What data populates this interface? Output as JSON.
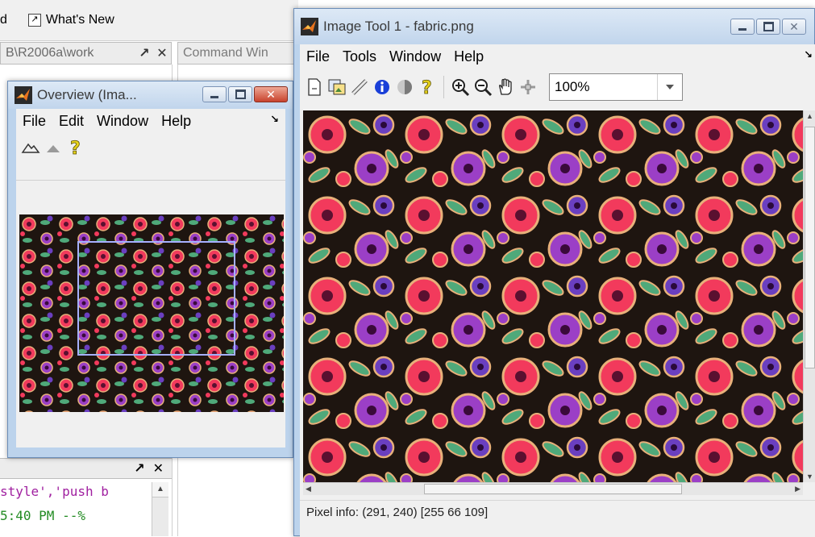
{
  "desktop": {
    "menu_fragment": "d",
    "whats_new": "What's New",
    "current_folder_path": "B\\R2006a\\work",
    "pane_undock": "↗",
    "pane_close": "✕",
    "command_window_title": "Command Win",
    "history_line_1": "style','push b",
    "history_line_2": "5:40 PM --%"
  },
  "overview_window": {
    "title": "Overview (Ima...",
    "menus": [
      "File",
      "Edit",
      "Window",
      "Help"
    ]
  },
  "image_tool": {
    "title": "Image Tool 1 - fabric.png",
    "menus": [
      "File",
      "Tools",
      "Window",
      "Help"
    ],
    "zoom": "100%",
    "status": "Pixel info: (291, 240)  [255 66 109]"
  },
  "colors": {
    "fabric_background": "#1e1510",
    "flower_red": "#f23a5c",
    "flower_purple": "#9b3fc6",
    "flower_violet": "#6a3fc0",
    "leaf_green": "#4fa97a",
    "outline_gold": "#e8b07a",
    "overview_rect": "#a6b0ff"
  }
}
